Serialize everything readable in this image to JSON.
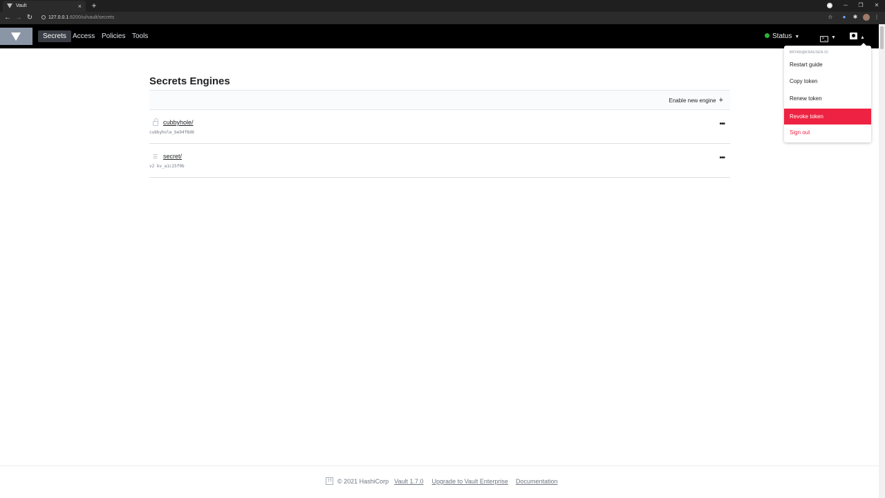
{
  "browser": {
    "tab_title": "Vault",
    "tab_close": "×",
    "new_tab": "+",
    "url_host": "127.0.0.1",
    "url_path": ":8200/ui/vault/secrets"
  },
  "header": {
    "nav": {
      "secrets": "Secrets",
      "access": "Access",
      "policies": "Policies",
      "tools": "Tools"
    },
    "status_label": "Status",
    "status_color": "#2eb039"
  },
  "main": {
    "title": "Secrets Engines",
    "enable_label": "Enable new engine",
    "engines": [
      {
        "name": "cubbyhole/",
        "accessor": "cubbyhole_be94f8d6",
        "icon": "lock-icon"
      },
      {
        "name": "secret/",
        "accessor": "v2 kv_a1c25f0b",
        "icon": "list-icon"
      }
    ],
    "more_label": "•••"
  },
  "user_menu": {
    "username": "BRYAN@KRAUSEN.IO",
    "items": [
      "Restart guide",
      "Copy token",
      "Renew token",
      "Revoke token",
      "Sign out"
    ],
    "danger_color": "#ee2242"
  },
  "footer": {
    "copyright": "© 2021 HashiCorp",
    "version": "Vault 1.7.0",
    "upgrade": "Upgrade to Vault Enterprise",
    "docs": "Documentation"
  }
}
